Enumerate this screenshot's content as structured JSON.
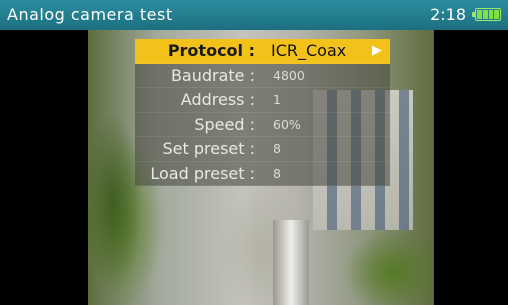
{
  "header": {
    "title": "Analog camera test",
    "clock": "2:18",
    "battery_icon": "battery-full-icon",
    "battery_color": "#7fe040"
  },
  "menu": {
    "items": [
      {
        "label": "Protocol :",
        "value": "ICR_Coax",
        "selected": true,
        "arrow_icon": "arrow-right-icon"
      },
      {
        "label": "Baudrate :",
        "value": "4800"
      },
      {
        "label": "Address :",
        "value": "1"
      },
      {
        "label": "Speed :",
        "value": "60%"
      },
      {
        "label": "Set preset :",
        "value": "8"
      },
      {
        "label": "Load preset :",
        "value": "8"
      }
    ],
    "highlight_color": "#f2c21b"
  }
}
